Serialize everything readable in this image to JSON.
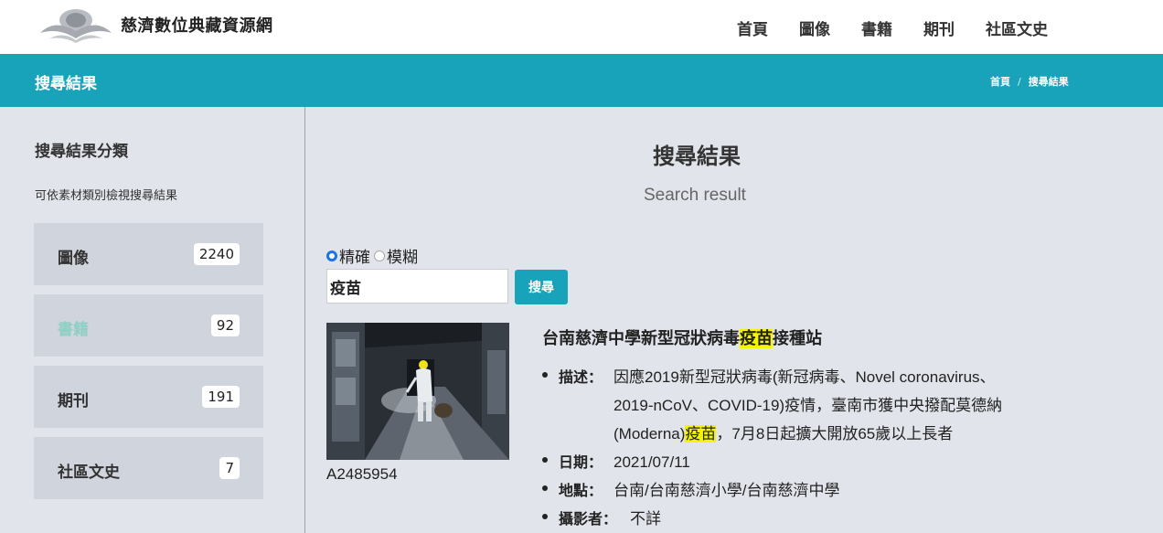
{
  "site": {
    "name": "慈濟數位典藏資源網"
  },
  "nav": [
    "首頁",
    "圖像",
    "書籍",
    "期刊",
    "社區文史"
  ],
  "banner": {
    "title": "搜尋結果",
    "breadcrumb": [
      "首頁",
      "搜尋結果"
    ]
  },
  "sidebar": {
    "title": "搜尋結果分類",
    "subtitle": "可依素材類別檢視搜尋結果",
    "categories": [
      {
        "label": "圖像",
        "count": "2240"
      },
      {
        "label": "書籍",
        "count": "92"
      },
      {
        "label": "期刊",
        "count": "191"
      },
      {
        "label": "社區文史",
        "count": "7"
      }
    ]
  },
  "main": {
    "title": "搜尋結果",
    "subtitle": "Search result",
    "mode_exact": "精確",
    "mode_fuzzy": "模糊",
    "query": "疫苗",
    "search_button": "搜尋"
  },
  "result": {
    "id": "A2485954",
    "title_pre": "台南慈濟中學新型冠狀病毒",
    "title_hl": "疫苗",
    "title_post": "接種站",
    "desc_key": "描述：",
    "desc_line1": "因應2019新型冠狀病毒(新冠病毒、Novel coronavirus、",
    "desc_line2": "2019-nCoV、COVID-19)疫情，臺南市獲中央撥配莫德納",
    "desc_line3_pre": "(Moderna)",
    "desc_line3_hl": "疫苗",
    "desc_line3_post": "，7月8日起擴大開放65歲以上長者",
    "date_key": "日期：",
    "date": "2021/07/11",
    "place_key": "地點：",
    "place": "台南/台南慈濟小學/台南慈濟中學",
    "photographer_key": "攝影者：",
    "photographer": "不詳"
  },
  "colors": {
    "accent": "#19a3bb",
    "highlight": "#f5f500",
    "background": "#e1e4ea"
  }
}
